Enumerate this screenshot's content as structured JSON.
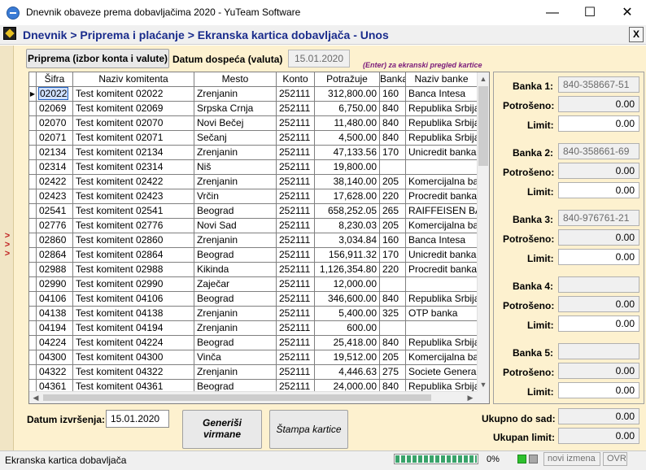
{
  "window": {
    "title": "Dnevnik obaveze prema dobavljačima 2020 - YuTeam Software",
    "minimize_glyph": "—",
    "maximize_glyph": "☐",
    "close_glyph": "✕"
  },
  "header": {
    "breadcrumb": "Dnevnik > Priprema i plaćanje > Ekranska kartica dobavljača - Unos",
    "close_label": "X"
  },
  "left_strip": {
    "arrows": "> > >"
  },
  "toolbar": {
    "priprema_button": "Priprema (izbor konta i valute)",
    "datum_dospeca_label": "Datum dospeća (valuta)",
    "datum_dospeca_value": "15.01.2020",
    "hint": "(Enter) za ekranski pregled kartice"
  },
  "grid": {
    "columns": [
      "Šifra",
      "Naziv komitenta",
      "Mesto",
      "Konto",
      "Potražuje",
      "Banka",
      "Naziv banke"
    ],
    "rows": [
      [
        "02022",
        "Test komitent 02022",
        "Zrenjanin",
        "252111",
        "312,800.00",
        "160",
        "Banca Intesa"
      ],
      [
        "02069",
        "Test komitent 02069",
        "Srpska Crnja",
        "252111",
        "6,750.00",
        "840",
        "Republika Srbija"
      ],
      [
        "02070",
        "Test komitent 02070",
        "Novi Bečej",
        "252111",
        "11,480.00",
        "840",
        "Republika Srbija"
      ],
      [
        "02071",
        "Test komitent 02071",
        "Sečanj",
        "252111",
        "4,500.00",
        "840",
        "Republika Srbija"
      ],
      [
        "02134",
        "Test komitent 02134",
        "Zrenjanin",
        "252111",
        "47,133.56",
        "170",
        "Unicredit banka"
      ],
      [
        "02314",
        "Test komitent 02314",
        "Niš",
        "252111",
        "19,800.00",
        "",
        ""
      ],
      [
        "02422",
        "Test komitent 02422",
        "Zrenjanin",
        "252111",
        "38,140.00",
        "205",
        "Komercijalna banka"
      ],
      [
        "02423",
        "Test komitent 02423",
        "Vrčin",
        "252111",
        "17,628.00",
        "220",
        "Procredit banka"
      ],
      [
        "02541",
        "Test komitent 02541",
        "Beograd",
        "252111",
        "658,252.05",
        "265",
        "RAIFFEISEN BANK"
      ],
      [
        "02776",
        "Test komitent 02776",
        "Novi Sad",
        "252111",
        "8,230.03",
        "205",
        "Komercijalna banka"
      ],
      [
        "02860",
        "Test komitent 02860",
        "Zrenjanin",
        "252111",
        "3,034.84",
        "160",
        "Banca Intesa"
      ],
      [
        "02864",
        "Test komitent 02864",
        "Beograd",
        "252111",
        "156,911.32",
        "170",
        "Unicredit banka"
      ],
      [
        "02988",
        "Test komitent 02988",
        "Kikinda",
        "252111",
        "1,126,354.80",
        "220",
        "Procredit banka"
      ],
      [
        "02990",
        "Test komitent 02990",
        "Zaječar",
        "252111",
        "12,000.00",
        "",
        ""
      ],
      [
        "04106",
        "Test komitent 04106",
        "Beograd",
        "252111",
        "346,600.00",
        "840",
        "Republika Srbija"
      ],
      [
        "04138",
        "Test komitent 04138",
        "Zrenjanin",
        "252111",
        "5,400.00",
        "325",
        "OTP banka"
      ],
      [
        "04194",
        "Test komitent 04194",
        "Zrenjanin",
        "252111",
        "600.00",
        "",
        ""
      ],
      [
        "04224",
        "Test komitent 04224",
        "Beograd",
        "252111",
        "25,418.00",
        "840",
        "Republika Srbija"
      ],
      [
        "04300",
        "Test komitent 04300",
        "Vinča",
        "252111",
        "19,512.00",
        "205",
        "Komercijalna banka"
      ],
      [
        "04322",
        "Test komitent 04322",
        "Zrenjanin",
        "252111",
        "4,446.63",
        "275",
        "Societe Generale"
      ],
      [
        "04361",
        "Test komitent 04361",
        "Beograd",
        "252111",
        "24,000.00",
        "840",
        "Republika Srbija"
      ]
    ]
  },
  "banks": [
    {
      "label": "Banka 1:",
      "account": "840-358667-51",
      "spent_label": "Potrošeno:",
      "spent": "0.00",
      "limit_label": "Limit:",
      "limit": "0.00"
    },
    {
      "label": "Banka 2:",
      "account": "840-358661-69",
      "spent_label": "Potrošeno:",
      "spent": "0.00",
      "limit_label": "Limit:",
      "limit": "0.00"
    },
    {
      "label": "Banka 3:",
      "account": "840-976761-21",
      "spent_label": "Potrošeno:",
      "spent": "0.00",
      "limit_label": "Limit:",
      "limit": "0.00"
    },
    {
      "label": "Banka 4:",
      "account": "",
      "spent_label": "Potrošeno:",
      "spent": "0.00",
      "limit_label": "Limit:",
      "limit": "0.00"
    },
    {
      "label": "Banka 5:",
      "account": "",
      "spent_label": "Potrošeno:",
      "spent": "0.00",
      "limit_label": "Limit:",
      "limit": "0.00"
    }
  ],
  "bottom": {
    "datum_izvrsenja_label": "Datum izvršenja:",
    "datum_izvrsenja_value": "15.01.2020",
    "generisi_line1": "Generiši",
    "generisi_line2": "virmane",
    "stampa_label": "Štampa kartice",
    "ukupno_label": "Ukupno do sad:",
    "ukupno_value": "0.00",
    "limit_label": "Ukupan limit:",
    "limit_value": "0.00"
  },
  "status": {
    "text": "Ekranska kartica dobavljača",
    "progress": 1.0,
    "percent": "0%",
    "izmena": "novi izmena",
    "ovr": "OVR"
  }
}
